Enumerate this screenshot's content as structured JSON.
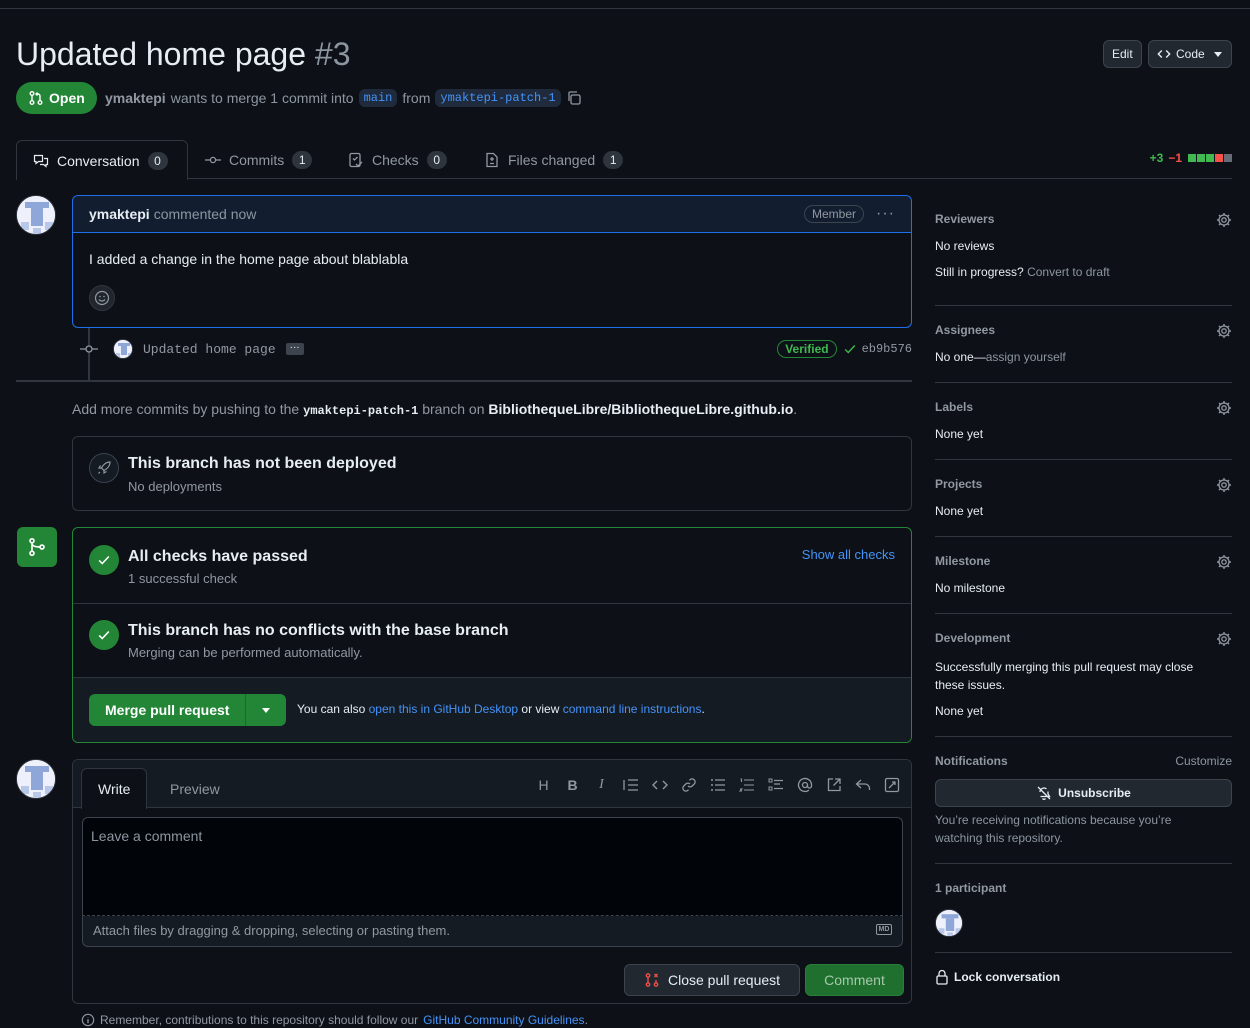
{
  "pr": {
    "title": "Updated home page",
    "number": "#3",
    "edit_label": "Edit",
    "code_label": "Code",
    "state": "Open",
    "author": "ymaktepi",
    "merge_text": "wants to merge 1 commit into",
    "base_branch": "main",
    "from_text": "from",
    "head_branch": "ymaktepi-patch-1"
  },
  "tabs": [
    {
      "label": "Conversation",
      "count": "0"
    },
    {
      "label": "Commits",
      "count": "1"
    },
    {
      "label": "Checks",
      "count": "0"
    },
    {
      "label": "Files changed",
      "count": "1"
    }
  ],
  "diffstat": {
    "additions": "+3",
    "deletions": "−1"
  },
  "comment": {
    "author": "ymaktepi",
    "when": "commented now",
    "role": "Member",
    "body": "I added a change in the home page about blablabla"
  },
  "commit": {
    "message": "Updated home page",
    "verified": "Verified",
    "sha": "eb9b576"
  },
  "add_more": {
    "prefix": "Add more commits by pushing to the",
    "branch": "ymaktepi-patch-1",
    "middle": "branch on",
    "repo": "BibliothequeLibre/BibliothequeLibre.github.io",
    "suffix": "."
  },
  "deploy": {
    "title": "This branch has not been deployed",
    "sub": "No deployments"
  },
  "checks": {
    "title": "All checks have passed",
    "sub": "1 successful check",
    "show_all": "Show all checks"
  },
  "conflicts": {
    "title": "This branch has no conflicts with the base branch",
    "sub": "Merging can be performed automatically."
  },
  "merge": {
    "button": "Merge pull request",
    "note_prefix": "You can also",
    "desktop_link": "open this in GitHub Desktop",
    "note_middle": "or view",
    "cli_link": "command line instructions",
    "note_suffix": "."
  },
  "editor": {
    "write_tab": "Write",
    "preview_tab": "Preview",
    "placeholder": "Leave a comment",
    "attach": "Attach files by dragging & dropping, selecting or pasting them.",
    "md_badge": "MD",
    "close_button": "Close pull request",
    "comment_button": "Comment",
    "reminder_prefix": "Remember, contributions to this repository should follow our",
    "reminder_link": "GitHub Community Guidelines",
    "reminder_suffix": ".",
    "toolbar": [
      "heading-icon",
      "bold-icon",
      "italic-icon",
      "quote-icon",
      "code-icon",
      "link-icon",
      "bulleted-list-icon",
      "numbered-list-icon",
      "task-list-icon",
      "mention-icon",
      "cross-reference-icon",
      "reply-icon",
      "fullscreen-icon"
    ]
  },
  "sidebar": {
    "reviewers": {
      "heading": "Reviewers",
      "value": "No reviews",
      "draft_prefix": "Still in progress?",
      "draft_link": "Convert to draft"
    },
    "assignees": {
      "heading": "Assignees",
      "value": "No one—",
      "assign_link": "assign yourself"
    },
    "labels": {
      "heading": "Labels",
      "value": "None yet"
    },
    "projects": {
      "heading": "Projects",
      "value": "None yet"
    },
    "milestone": {
      "heading": "Milestone",
      "value": "No milestone"
    },
    "development": {
      "heading": "Development",
      "text": "Successfully merging this pull request may close these issues.",
      "value": "None yet"
    },
    "notifications": {
      "heading": "Notifications",
      "customize": "Customize",
      "unsubscribe": "Unsubscribe",
      "reason": "You’re receiving notifications because you’re watching this repository."
    },
    "participants": {
      "heading": "1 participant"
    },
    "lock": "Lock conversation"
  },
  "colors": {
    "background": "#0d1117",
    "accent_green": "#238636",
    "link_blue": "#4493f8",
    "danger_red": "#f85149"
  }
}
